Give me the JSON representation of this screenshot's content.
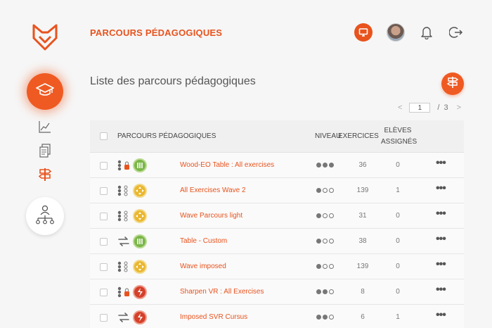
{
  "header": {
    "title": "PARCOURS PÉDAGOGIQUES",
    "brand_color": "#e8531e"
  },
  "icons": {
    "logo": "fox-logo-icon",
    "monitor": "monitor-icon",
    "avatar": "user-avatar",
    "notifications": "bell-icon",
    "logout": "logout-icon",
    "nav_courses": "graduation-cap-icon",
    "nav_stats": "chart-line-icon",
    "nav_docs": "documents-icon",
    "nav_paths": "signpost-icon",
    "nav_org": "org-chart-icon",
    "add_path": "signpost-add-icon"
  },
  "main": {
    "section_title": "Liste des parcours pédagogiques",
    "pagination": {
      "prev": "<",
      "current_page": "1",
      "separator": "/",
      "total_pages": "3",
      "next": ">"
    },
    "table": {
      "columns": {
        "name": "PARCOURS PÉDAGOGIQUES",
        "level": "NIVEAU",
        "exercises": "EXERCICES",
        "students_line1": "ELÈVES",
        "students_line2": "ASSIGNÉS"
      },
      "rows": [
        {
          "name": "Wood-EO Table : All exercises",
          "type": "sequence-locked",
          "level_badge": "green",
          "level": 3,
          "exercises": "36",
          "students": "0",
          "more": "•••"
        },
        {
          "name": "All Exercises Wave 2",
          "type": "sequence",
          "level_badge": "yellow",
          "level": 1,
          "exercises": "139",
          "students": "1",
          "more": "•••"
        },
        {
          "name": "Wave Parcours light",
          "type": "sequence",
          "level_badge": "yellow",
          "level": 1,
          "exercises": "31",
          "students": "0",
          "more": "•••"
        },
        {
          "name": "Table - Custom",
          "type": "loop",
          "level_badge": "green",
          "level": 1,
          "exercises": "38",
          "students": "0",
          "more": "•••"
        },
        {
          "name": "Wave imposed",
          "type": "sequence",
          "level_badge": "yellow",
          "level": 1,
          "exercises": "139",
          "students": "0",
          "more": "•••"
        },
        {
          "name": "Sharpen VR : All Exercises",
          "type": "sequence-locked",
          "level_badge": "red",
          "level": 2,
          "exercises": "8",
          "students": "0",
          "more": "•••"
        },
        {
          "name": "Imposed SVR Cursus",
          "type": "loop",
          "level_badge": "red",
          "level": 2,
          "exercises": "6",
          "students": "1",
          "more": "•••"
        }
      ]
    }
  }
}
